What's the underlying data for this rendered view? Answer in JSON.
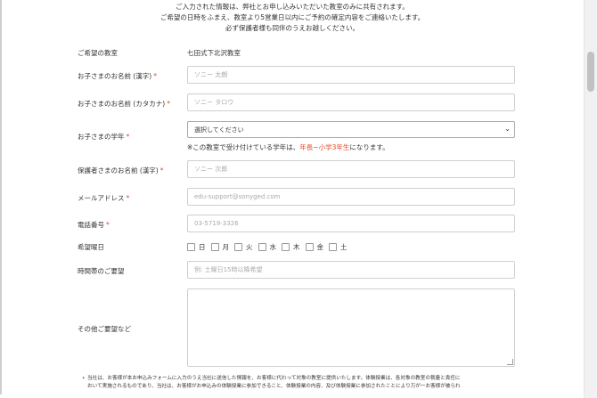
{
  "intro": [
    "ご入力された情報は、弊社とお申し込みいただいた教室のみに共有されます。",
    "ご希望の日時をふまえ、教室より5営業日以内にご予約の確定内容をご連絡いたします。",
    "必ず保護者様も同伴のうえお越しください。"
  ],
  "form": {
    "classroom_label": "ご希望の教室",
    "classroom_value": "七田式下北沢教室",
    "child_name_label": "お子さまのお名前 (漢字)",
    "child_name_placeholder": "ソニー 太朗",
    "child_kana_label": "お子さまのお名前 (カタカナ)",
    "child_kana_placeholder": "ソニー タロウ",
    "grade_label": "お子さまの学年",
    "grade_selected": "選択してください",
    "grade_note_prefix": "※この教室で受け付けている学年は、",
    "grade_note_highlight": "年長~小学3年生",
    "grade_note_suffix": "になります。",
    "parent_name_label": "保護者さまのお名前 (漢字)",
    "parent_name_placeholder": "ソニー 次郎",
    "email_label": "メールアドレス",
    "email_placeholder": "edu-support@sonyged.com",
    "phone_label": "電話番号",
    "phone_placeholder": "03-5719-3326",
    "days_label": "希望曜日",
    "days": [
      "日",
      "月",
      "火",
      "水",
      "木",
      "金",
      "土"
    ],
    "time_label": "時間帯のご要望",
    "time_placeholder": "例: 土曜日15時以降希望",
    "other_label": "その他ご要望など",
    "required_mark": "*"
  },
  "footer": {
    "bullet": "•",
    "line1": "当社は、お客様が本お申込みフォームに入力のうえ当社に送信した情報を、お客様に代わって対象の教室に提供いたします。体験授業は、各対象の教室の裁量と責任に",
    "line2": "おいて実施されるものであり、当社は、お客様がお申込みの体験授業に参加できること、体験授業の内容、及び体験授業に参加されたことにより万が一お客様が被られ"
  },
  "colors": {
    "required": "#e0482b",
    "highlight": "#e0482b"
  }
}
